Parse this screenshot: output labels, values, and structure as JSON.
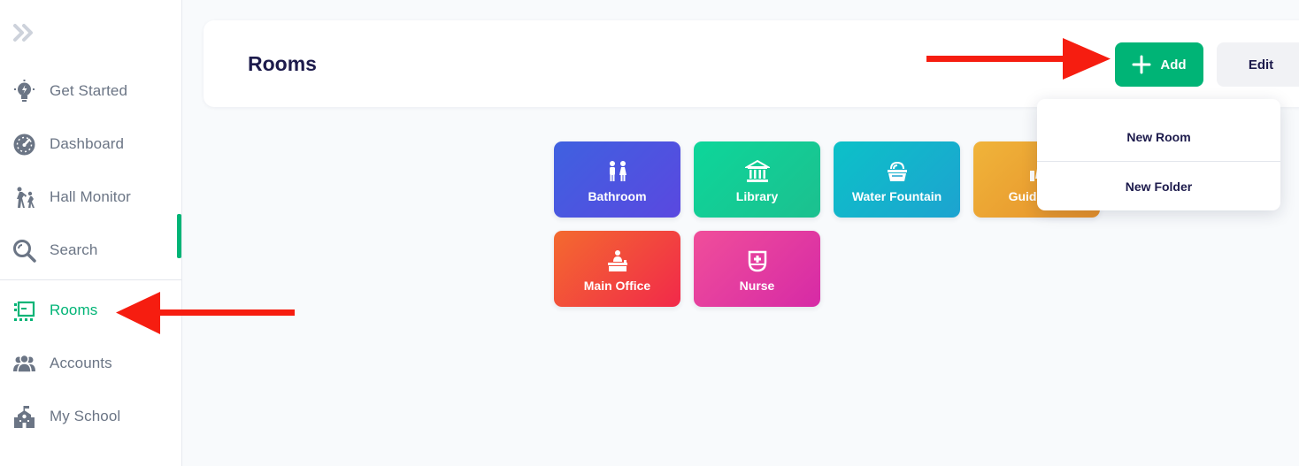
{
  "sidebar": {
    "items": [
      {
        "label": "Get Started",
        "icon": "lightbulb-icon"
      },
      {
        "label": "Dashboard",
        "icon": "gauge-icon"
      },
      {
        "label": "Hall Monitor",
        "icon": "walking-people-icon"
      },
      {
        "label": "Search",
        "icon": "search-icon"
      },
      {
        "label": "Rooms",
        "icon": "rooms-icon",
        "active": true
      },
      {
        "label": "Accounts",
        "icon": "users-icon"
      },
      {
        "label": "My School",
        "icon": "school-icon"
      }
    ]
  },
  "header": {
    "title": "Rooms",
    "add_label": "Add",
    "edit_label": "Edit"
  },
  "add_menu": {
    "items": [
      "New Room",
      "New Folder"
    ]
  },
  "rooms": [
    {
      "label": "Bathroom",
      "icon": "bathroom-icon"
    },
    {
      "label": "Library",
      "icon": "library-icon"
    },
    {
      "label": "Water Fountain",
      "icon": "water-fountain-icon"
    },
    {
      "label": "Guidance",
      "icon": "guidance-icon"
    },
    {
      "label": "Main Office",
      "icon": "office-desk-icon"
    },
    {
      "label": "Nurse",
      "icon": "nurse-icon"
    }
  ],
  "colors": {
    "accent": "#00b476",
    "title": "#1d1b4c",
    "nav_text": "#6b7585",
    "annotation_arrow": "#f61d10"
  }
}
